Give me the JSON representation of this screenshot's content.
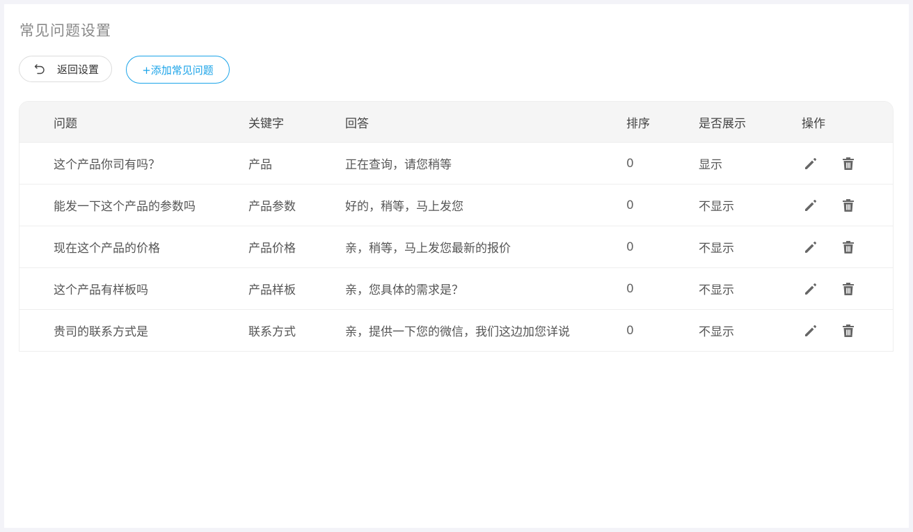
{
  "page": {
    "title": "常见问题设置"
  },
  "toolbar": {
    "back_label": "返回设置",
    "add_label": "+添加常见问题"
  },
  "table": {
    "headers": {
      "question": "问题",
      "keyword": "关键字",
      "answer": "回答",
      "sort": "排序",
      "display": "是否展示",
      "action": "操作"
    },
    "rows": [
      {
        "question": "这个产品你司有吗？",
        "keyword": "产品",
        "answer": "正在查询，请您稍等",
        "sort": "0",
        "display": "显示"
      },
      {
        "question": "能发一下这个产品的参数吗",
        "keyword": "产品参数",
        "answer": "好的，稍等，马上发您",
        "sort": "0",
        "display": "不显示"
      },
      {
        "question": "现在这个产品的价格",
        "keyword": "产品价格",
        "answer": "亲，稍等，马上发您最新的报价",
        "sort": "0",
        "display": "不显示"
      },
      {
        "question": "这个产品有样板吗",
        "keyword": "产品样板",
        "answer": "亲，您具体的需求是？",
        "sort": "0",
        "display": "不显示"
      },
      {
        "question": "贵司的联系方式是",
        "keyword": "联系方式",
        "answer": "亲，提供一下您的微信，我们这边加您详说",
        "sort": "0",
        "display": "不显示"
      }
    ]
  },
  "icons": {
    "back": "undo-arrow-icon",
    "edit": "pencil-icon",
    "delete": "trash-icon"
  },
  "colors": {
    "accent": "#1aa3e8",
    "header_bg": "#f5f5f5",
    "icon": "#666666"
  }
}
